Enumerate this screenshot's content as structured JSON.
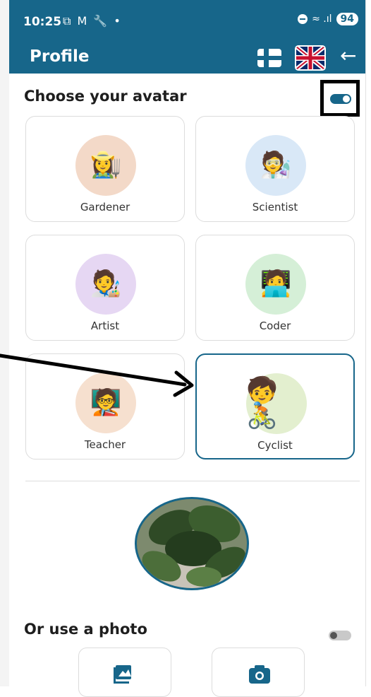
{
  "status_bar": {
    "time": "10:25",
    "left_icons": "⧉ M 🔧 •",
    "signal_icons": "≈ .ıl",
    "battery": "94"
  },
  "app_bar": {
    "title": "Profile",
    "background_color": "#17668a"
  },
  "avatar_section": {
    "title": "Choose your avatar",
    "toggle_on": true
  },
  "avatars": [
    {
      "label": "Gardener",
      "emoji": "👩‍🌾",
      "bg": "#f3d9c8"
    },
    {
      "label": "Scientist",
      "emoji": "🧑‍🔬",
      "bg": "#d9e8f7"
    },
    {
      "label": "Artist",
      "emoji": "🧑‍🎨",
      "bg": "#e6d7f3"
    },
    {
      "label": "Coder",
      "emoji": "🧑‍💻",
      "bg": "#d5efd7"
    },
    {
      "label": "Teacher",
      "emoji": "🧑‍🏫",
      "bg": "#f6e0cf"
    },
    {
      "label": "Cyclist",
      "emoji": "🧒🚴",
      "bg": "#e3efcf",
      "selected": true
    }
  ],
  "photo_section": {
    "title": "Or use a photo",
    "toggle_on": false
  }
}
